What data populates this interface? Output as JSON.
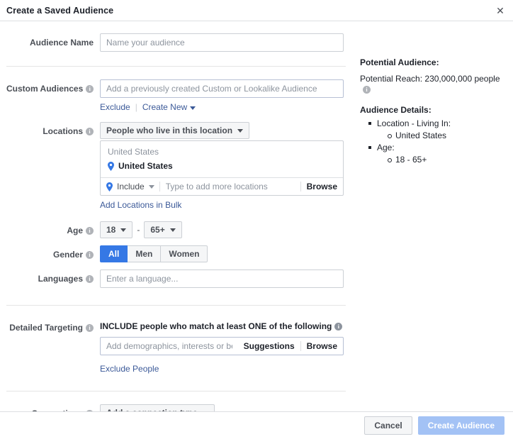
{
  "header": {
    "title": "Create a Saved Audience",
    "close_label": "✕"
  },
  "form": {
    "audience_name": {
      "label": "Audience Name",
      "placeholder": "Name your audience",
      "value": ""
    },
    "custom_audiences": {
      "label": "Custom Audiences",
      "placeholder": "Add a previously created Custom or Lookalike Audience",
      "value": "",
      "exclude_link": "Exclude",
      "create_new_link": "Create New"
    },
    "locations": {
      "label": "Locations",
      "scope_dropdown": "People who live in this location",
      "box_header": "United States",
      "selected_location": "United States",
      "include_label": "Include",
      "typeahead_placeholder": "Type to add more locations",
      "browse_label": "Browse",
      "bulk_link": "Add Locations in Bulk"
    },
    "age": {
      "label": "Age",
      "min": "18",
      "max": "65+",
      "separator": "-"
    },
    "gender": {
      "label": "Gender",
      "options": [
        "All",
        "Men",
        "Women"
      ],
      "selected": "All"
    },
    "languages": {
      "label": "Languages",
      "placeholder": "Enter a language...",
      "value": ""
    },
    "detailed_targeting": {
      "label": "Detailed Targeting",
      "include_heading": "INCLUDE people who match at least ONE of the following",
      "placeholder": "Add demographics, interests or behaviors",
      "value": "",
      "suggestions_label": "Suggestions",
      "browse_label": "Browse",
      "exclude_link": "Exclude People"
    },
    "connections": {
      "label": "Connections",
      "dropdown": "Add a connection type"
    }
  },
  "sidebar": {
    "potential_audience_heading": "Potential Audience:",
    "potential_reach": "Potential Reach: 230,000,000 people",
    "audience_details_heading": "Audience Details:",
    "details": [
      {
        "label": "Location - Living In:",
        "children": [
          "United States"
        ]
      },
      {
        "label": "Age:",
        "children": [
          "18 - 65+"
        ]
      }
    ]
  },
  "footer": {
    "cancel_label": "Cancel",
    "submit_label": "Create Audience"
  },
  "colors": {
    "accent_blue": "#3578e5",
    "link_blue": "#3b5998",
    "primary_disabled": "#a3c2f5",
    "border": "#ccd0d5",
    "text": "#1d2129",
    "muted": "#8d949e"
  }
}
